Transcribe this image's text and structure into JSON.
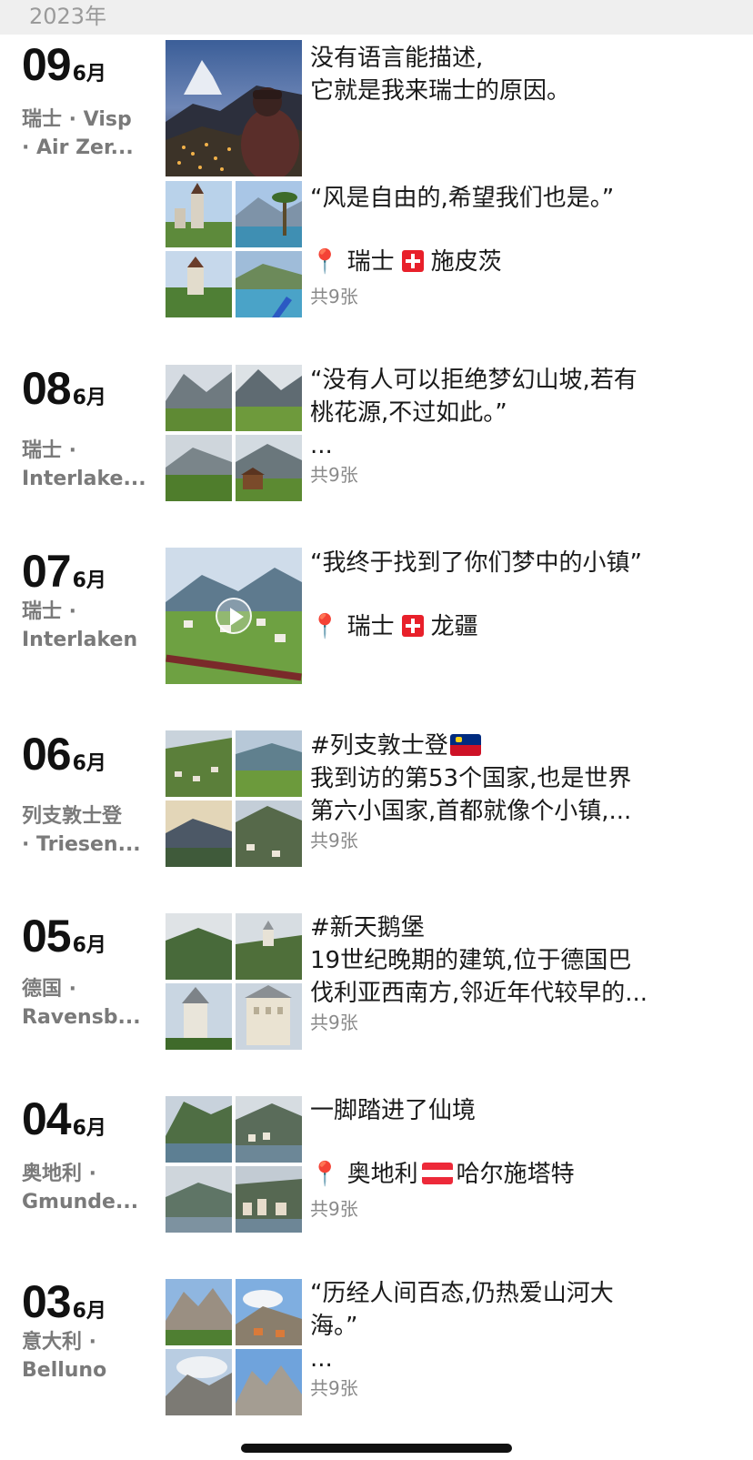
{
  "year": "2023年",
  "entries": [
    {
      "day": "09",
      "month": "6月",
      "location": [
        "瑞士 · Visp",
        "· Air Zer..."
      ],
      "photos": [
        {
          "caption_lines": [
            "没有语言能描述,",
            "它就是我来瑞士的原因。"
          ]
        },
        {
          "caption_lines": [
            "“风是自由的,希望我们也是。”"
          ],
          "place": {
            "country": "瑞士",
            "flag": "flag-switzerland",
            "city": "施皮茨"
          },
          "count": "共9张"
        }
      ]
    },
    {
      "day": "08",
      "month": "6月",
      "location": [
        "瑞士 ·",
        "Interlake..."
      ],
      "caption_lines": [
        "“没有人可以拒绝梦幻山坡,若有",
        "桃花源,不过如此。”",
        "..."
      ],
      "count": "共9张"
    },
    {
      "day": "07",
      "month": "6月",
      "location": [
        "瑞士 ·",
        "Interlaken"
      ],
      "caption_lines": [
        "“我终于找到了你们梦中的小镇”"
      ],
      "place": {
        "country": "瑞士",
        "flag": "flag-switzerland",
        "city": "龙疆"
      },
      "video": true
    },
    {
      "day": "06",
      "month": "6月",
      "location": [
        "列支敦士登",
        "· Triesen..."
      ],
      "caption_lines": [
        "#列支敦士登",
        "我到访的第53个国家,也是世界",
        "第六小国家,首都就像个小镇,..."
      ],
      "count": "共9张"
    },
    {
      "day": "05",
      "month": "6月",
      "location": [
        "德国 ·",
        "Ravensb..."
      ],
      "caption_lines": [
        "#新天鹅堡",
        "19世纪晚期的建筑,位于德国巴",
        "伐利亚西南方,邻近年代较早的..."
      ],
      "count": "共9张"
    },
    {
      "day": "04",
      "month": "6月",
      "location": [
        "奥地利 ·",
        "Gmunde..."
      ],
      "caption_lines": [
        "一脚踏进了仙境"
      ],
      "place": {
        "country": "奥地利",
        "flag": "flag-austria",
        "city": "哈尔施塔特"
      },
      "count": "共9张"
    },
    {
      "day": "03",
      "month": "6月",
      "location": [
        "意大利 ·",
        "Belluno"
      ],
      "caption_lines": [
        "“历经人间百态,仍热爱山河大",
        "海。”",
        "..."
      ],
      "count": "共9张"
    }
  ]
}
